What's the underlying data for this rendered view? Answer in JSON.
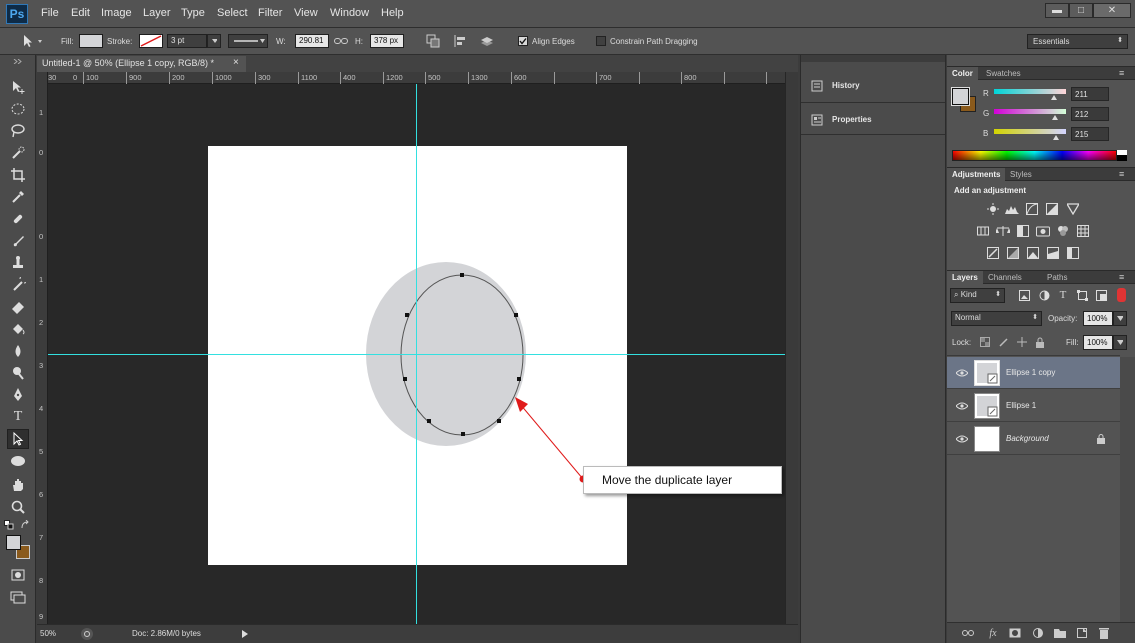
{
  "app": {
    "logo": "Ps"
  },
  "menu": {
    "items": [
      "File",
      "Edit",
      "Image",
      "Layer",
      "Type",
      "Select",
      "Filter",
      "View",
      "Window",
      "Help"
    ]
  },
  "window_controls": {
    "minimize": "▬",
    "maximize": "□",
    "close": "✕"
  },
  "options": {
    "fill_label": "Fill:",
    "stroke_label": "Stroke:",
    "stroke_width": "3 pt",
    "w_label": "W:",
    "w_value": "290.81",
    "h_label": "H:",
    "h_value": "378 px",
    "align_edges": "Align Edges",
    "constrain": "Constrain Path Dragging",
    "workspace": "Essentials"
  },
  "document": {
    "tab_title": "Untitled-1 @ 50% (Ellipse 1 copy, RGB/8) *",
    "tab_close": "×",
    "zoom": "50%",
    "doc_info": "Doc: 2.86M/0 bytes"
  },
  "ruler": {
    "h_labels": [
      "0",
      "100",
      "200",
      "300",
      "400",
      "500",
      "600",
      "700",
      "800",
      "900",
      "1000",
      "1100",
      "1200",
      "1300"
    ],
    "h_partial": "30",
    "v_labels": [
      "1",
      "0",
      "0",
      "1",
      "2",
      "3",
      "4",
      "5",
      "6",
      "7",
      "8",
      "9"
    ]
  },
  "callout": {
    "text": "Move the duplicate layer"
  },
  "dock": {
    "history": "History",
    "properties": "Properties"
  },
  "color_panel": {
    "tabs": [
      "Color",
      "Swatches"
    ],
    "r_label": "R",
    "r_value": "211",
    "g_label": "G",
    "g_value": "212",
    "b_label": "B",
    "b_value": "215",
    "fg_color": "#d3d4d7",
    "bg_color": "#8a5a1c"
  },
  "adjustments_panel": {
    "tabs": [
      "Adjustments",
      "Styles"
    ],
    "title": "Add an adjustment"
  },
  "layers_panel": {
    "tabs": [
      "Layers",
      "Channels",
      "Paths"
    ],
    "filter_kind": "Kind",
    "blend_mode": "Normal",
    "opacity_label": "Opacity:",
    "opacity_value": "100%",
    "lock_label": "Lock:",
    "fill_label": "Fill:",
    "fill_value": "100%",
    "layers": [
      {
        "name": "Ellipse 1 copy",
        "selected": true
      },
      {
        "name": "Ellipse 1",
        "selected": false
      },
      {
        "name": "Background",
        "selected": false,
        "locked": true
      }
    ]
  },
  "colors": {
    "guide": "#33e0e0",
    "ellipse_fill": "#d3d4d7",
    "arrow": "#e01b1b"
  }
}
